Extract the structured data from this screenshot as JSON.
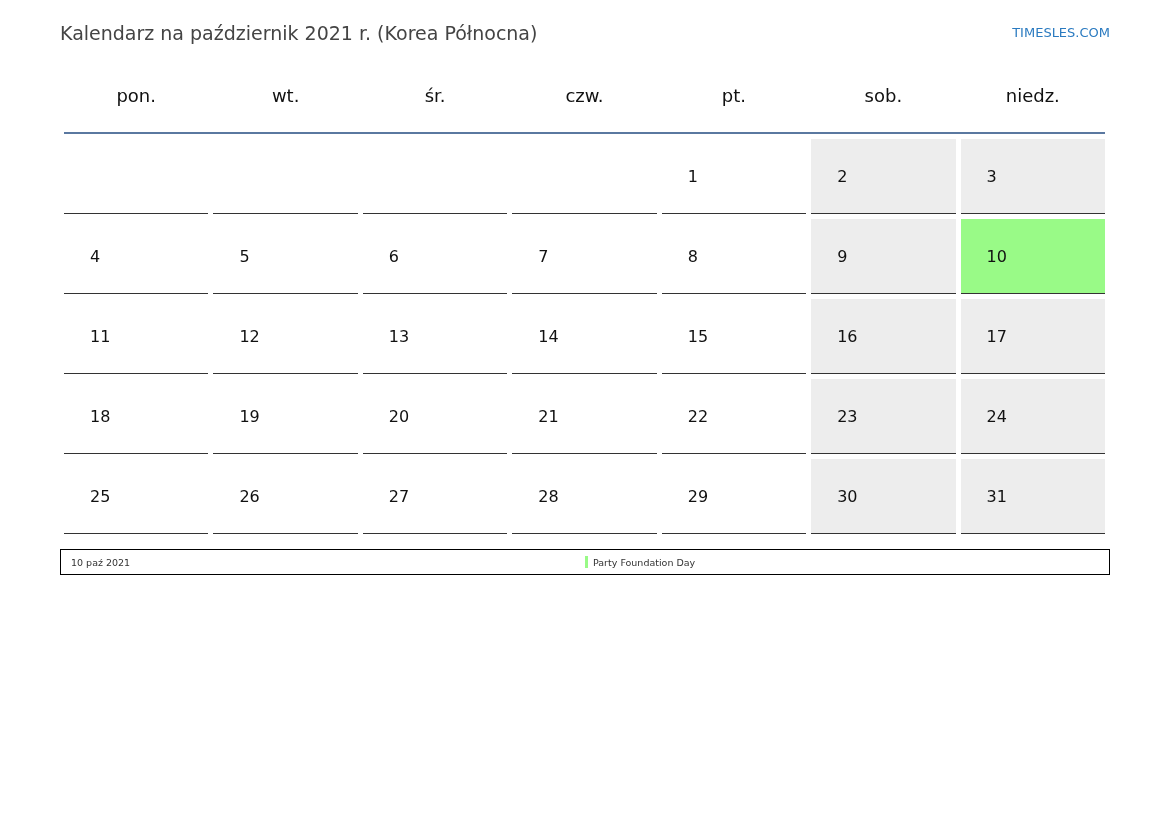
{
  "title": "Kalendarz na październik 2021 r. (Korea Północna)",
  "site": "TIMESLES.COM",
  "weekdays": [
    "pon.",
    "wt.",
    "śr.",
    "czw.",
    "pt.",
    "sob.",
    "niedz."
  ],
  "weeks": [
    [
      {
        "kind": "blank",
        "weekend": false
      },
      {
        "kind": "blank",
        "weekend": false
      },
      {
        "kind": "blank",
        "weekend": false
      },
      {
        "kind": "blank",
        "weekend": false
      },
      {
        "kind": "day",
        "day": "1",
        "weekend": false,
        "holiday": false
      },
      {
        "kind": "day",
        "day": "2",
        "weekend": true,
        "holiday": false
      },
      {
        "kind": "day",
        "day": "3",
        "weekend": true,
        "holiday": false
      }
    ],
    [
      {
        "kind": "day",
        "day": "4",
        "weekend": false,
        "holiday": false
      },
      {
        "kind": "day",
        "day": "5",
        "weekend": false,
        "holiday": false
      },
      {
        "kind": "day",
        "day": "6",
        "weekend": false,
        "holiday": false
      },
      {
        "kind": "day",
        "day": "7",
        "weekend": false,
        "holiday": false
      },
      {
        "kind": "day",
        "day": "8",
        "weekend": false,
        "holiday": false
      },
      {
        "kind": "day",
        "day": "9",
        "weekend": true,
        "holiday": false
      },
      {
        "kind": "day",
        "day": "10",
        "weekend": true,
        "holiday": true,
        "color": "#99fa87"
      }
    ],
    [
      {
        "kind": "day",
        "day": "11",
        "weekend": false,
        "holiday": false
      },
      {
        "kind": "day",
        "day": "12",
        "weekend": false,
        "holiday": false
      },
      {
        "kind": "day",
        "day": "13",
        "weekend": false,
        "holiday": false
      },
      {
        "kind": "day",
        "day": "14",
        "weekend": false,
        "holiday": false
      },
      {
        "kind": "day",
        "day": "15",
        "weekend": false,
        "holiday": false
      },
      {
        "kind": "day",
        "day": "16",
        "weekend": true,
        "holiday": false
      },
      {
        "kind": "day",
        "day": "17",
        "weekend": true,
        "holiday": false
      }
    ],
    [
      {
        "kind": "day",
        "day": "18",
        "weekend": false,
        "holiday": false
      },
      {
        "kind": "day",
        "day": "19",
        "weekend": false,
        "holiday": false
      },
      {
        "kind": "day",
        "day": "20",
        "weekend": false,
        "holiday": false
      },
      {
        "kind": "day",
        "day": "21",
        "weekend": false,
        "holiday": false
      },
      {
        "kind": "day",
        "day": "22",
        "weekend": false,
        "holiday": false
      },
      {
        "kind": "day",
        "day": "23",
        "weekend": true,
        "holiday": false
      },
      {
        "kind": "day",
        "day": "24",
        "weekend": true,
        "holiday": false
      }
    ],
    [
      {
        "kind": "day",
        "day": "25",
        "weekend": false,
        "holiday": false
      },
      {
        "kind": "day",
        "day": "26",
        "weekend": false,
        "holiday": false
      },
      {
        "kind": "day",
        "day": "27",
        "weekend": false,
        "holiday": false
      },
      {
        "kind": "day",
        "day": "28",
        "weekend": false,
        "holiday": false
      },
      {
        "kind": "day",
        "day": "29",
        "weekend": false,
        "holiday": false
      },
      {
        "kind": "day",
        "day": "30",
        "weekend": true,
        "holiday": false
      },
      {
        "kind": "day",
        "day": "31",
        "weekend": true,
        "holiday": false
      }
    ]
  ],
  "holidays": [
    {
      "date": "10 paź 2021",
      "name": "Party Foundation Day",
      "color": "#99fa87"
    }
  ]
}
